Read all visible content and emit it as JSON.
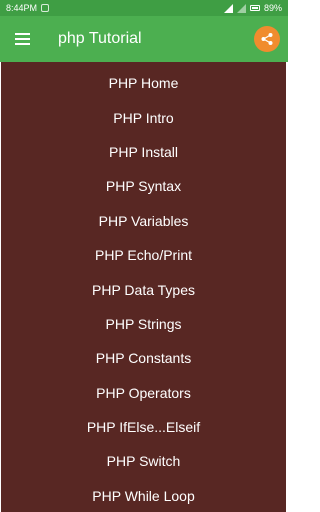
{
  "status_bar": {
    "time": "8:44PM",
    "battery": "89%"
  },
  "app_bar": {
    "title": "php Tutorial",
    "menu_icon": "hamburger-menu-icon",
    "share_icon": "share-icon"
  },
  "colors": {
    "app_bar": "#4caf50",
    "status_bar": "#3f9e44",
    "share_button": "#f08c2e",
    "list_background": "#582723",
    "list_text": "#ffffff"
  },
  "menu": {
    "items": [
      {
        "label": "PHP Home"
      },
      {
        "label": "PHP Intro"
      },
      {
        "label": "PHP Install"
      },
      {
        "label": "PHP Syntax"
      },
      {
        "label": "PHP Variables"
      },
      {
        "label": "PHP Echo/Print"
      },
      {
        "label": "PHP Data Types"
      },
      {
        "label": "PHP Strings"
      },
      {
        "label": "PHP Constants"
      },
      {
        "label": "PHP Operators"
      },
      {
        "label": "PHP IfElse...Elseif"
      },
      {
        "label": "PHP Switch"
      },
      {
        "label": "PHP While Loop"
      }
    ]
  }
}
